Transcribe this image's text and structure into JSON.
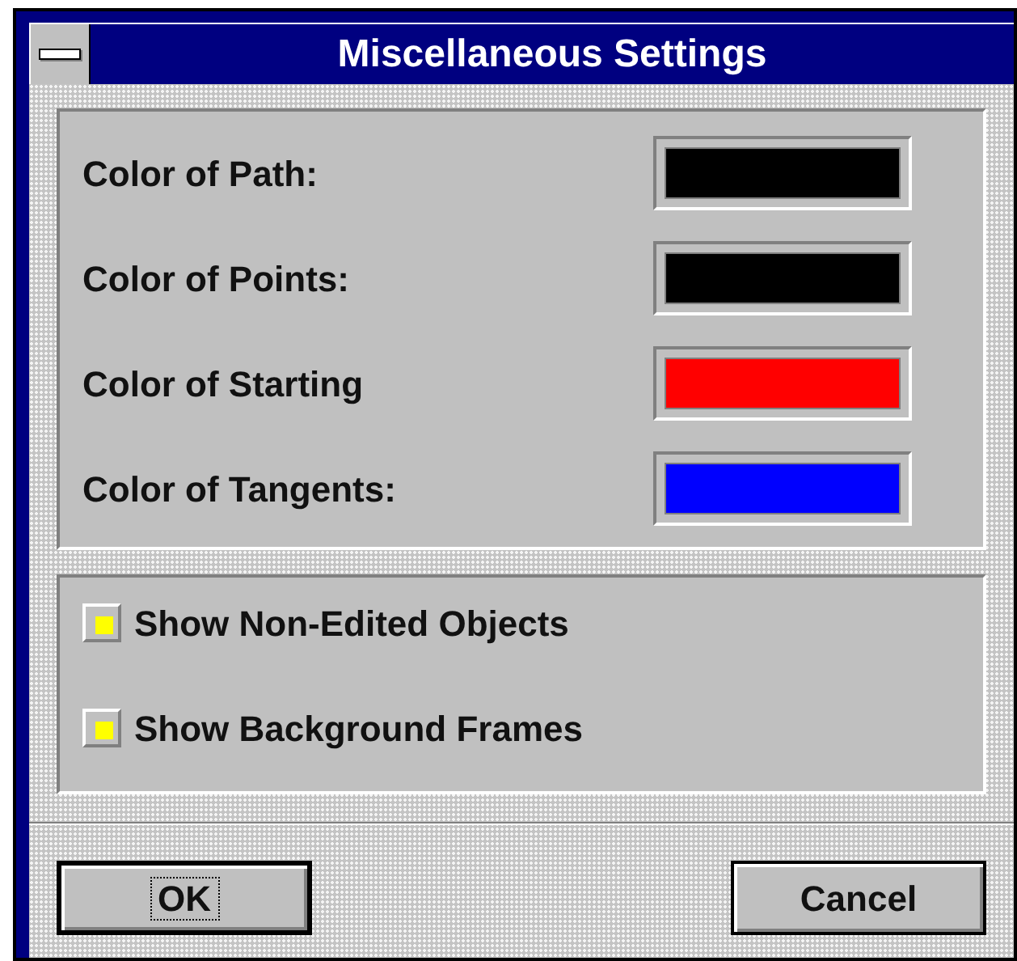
{
  "window": {
    "title": "Miscellaneous Settings"
  },
  "colors": [
    {
      "label": "Color of Path:",
      "color": "#000000"
    },
    {
      "label": "Color of Points:",
      "color": "#000000"
    },
    {
      "label": "Color of Starting",
      "color": "#ff0000"
    },
    {
      "label": "Color of Tangents:",
      "color": "#0000ff"
    }
  ],
  "options": [
    {
      "label": "Show Non-Edited Objects",
      "checked": true
    },
    {
      "label": "Show Background Frames",
      "checked": true
    }
  ],
  "buttons": [
    {
      "label": "OK",
      "default": true
    },
    {
      "label": "Cancel",
      "default": false
    }
  ]
}
